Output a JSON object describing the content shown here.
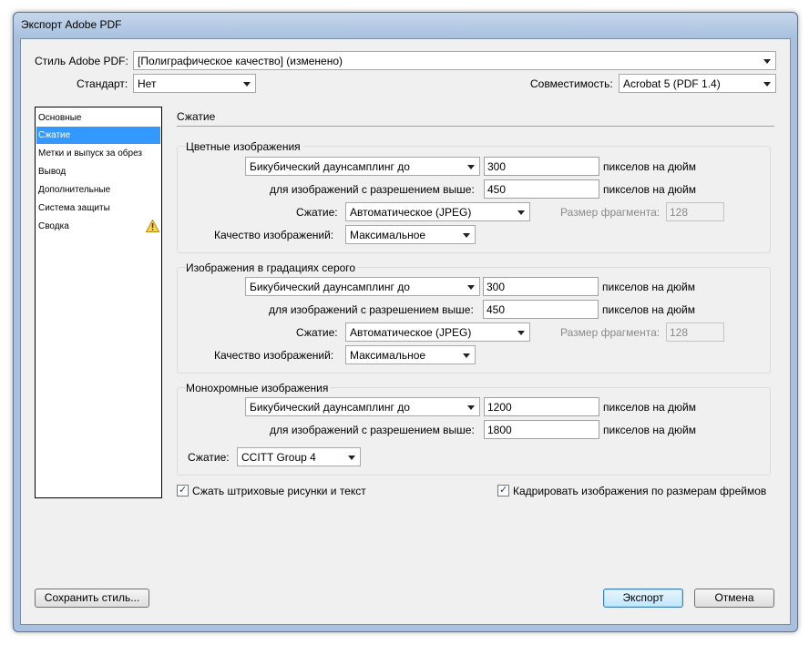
{
  "window": {
    "title": "Экспорт Adobe PDF"
  },
  "header": {
    "style_label": "Стиль Adobe PDF:",
    "style_value": "[Полиграфическое качество] (изменено)",
    "standard_label": "Стандарт:",
    "standard_value": "Нет",
    "compat_label": "Совместимость:",
    "compat_value": "Acrobat 5 (PDF 1.4)"
  },
  "sidebar": {
    "items": [
      {
        "label": "Основные"
      },
      {
        "label": "Сжатие"
      },
      {
        "label": "Метки и выпуск за обрез"
      },
      {
        "label": "Вывод"
      },
      {
        "label": "Дополнительные"
      },
      {
        "label": "Система защиты"
      },
      {
        "label": "Сводка"
      }
    ],
    "selected": "Сжатие",
    "warning_icon": "warning-triangle-icon",
    "accent_color": "#3399ff"
  },
  "main": {
    "section_title": "Сжатие",
    "color_images": {
      "title": "Цветные изображения",
      "downsample_method": "Бикубический даунсамплинг до",
      "downsample_value": "300",
      "ppi_label": "пикселов на дюйм",
      "above_label": "для изображений с разрешением выше:",
      "above_value": "450",
      "ppi_label2": "пикселов на дюйм",
      "compression_label": "Сжатие:",
      "compression_value": "Автоматическое (JPEG)",
      "tile_label": "Размер фрагмента:",
      "tile_value": "128",
      "quality_label": "Качество изображений:",
      "quality_value": "Максимальное"
    },
    "gray_images": {
      "title": "Изображения в градациях серого",
      "downsample_method": "Бикубический даунсамплинг до",
      "downsample_value": "300",
      "ppi_label": "пикселов на дюйм",
      "above_label": "для изображений с разрешением выше:",
      "above_value": "450",
      "ppi_label2": "пикселов на дюйм",
      "compression_label": "Сжатие:",
      "compression_value": "Автоматическое (JPEG)",
      "tile_label": "Размер фрагмента:",
      "tile_value": "128",
      "quality_label": "Качество изображений:",
      "quality_value": "Максимальное"
    },
    "mono_images": {
      "title": "Монохромные изображения",
      "downsample_method": "Бикубический даунсамплинг до",
      "downsample_value": "1200",
      "ppi_label": "пикселов на дюйм",
      "above_label": "для изображений с разрешением выше:",
      "above_value": "1800",
      "ppi_label2": "пикселов на дюйм",
      "compression_label": "Сжатие:",
      "compression_value": "CCITT Group 4"
    },
    "compress_text_label": "Сжать штриховые рисунки и текст",
    "compress_text_checked": true,
    "crop_images_label": "Кадрировать изображения по размерам фреймов",
    "crop_images_checked": true
  },
  "footer": {
    "save_style": "Сохранить стиль...",
    "export": "Экспорт",
    "cancel": "Отмена"
  }
}
